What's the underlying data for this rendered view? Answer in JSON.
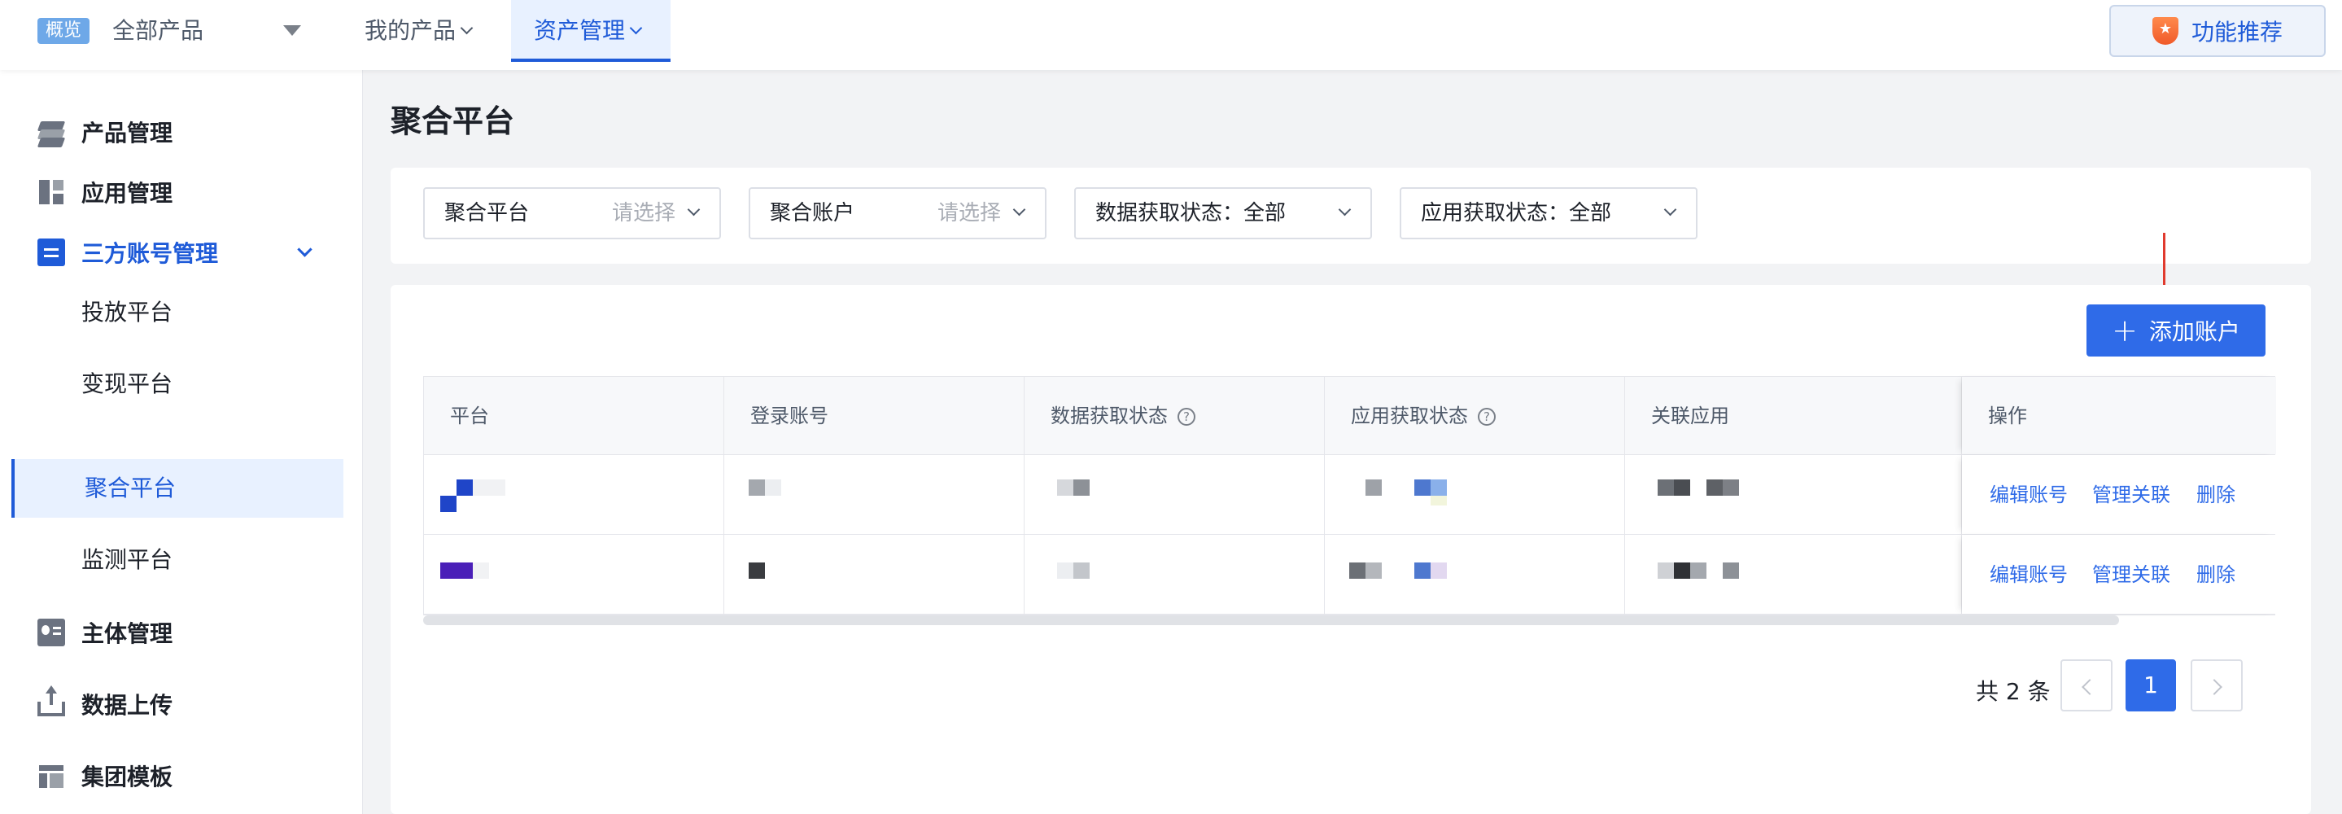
{
  "topnav": {
    "overview_badge": "概览",
    "product_select": "全部产品",
    "tabs": [
      {
        "label": "我的产品",
        "active": false
      },
      {
        "label": "资产管理",
        "active": true
      }
    ],
    "feature_button": "功能推荐"
  },
  "sidebar": {
    "items": [
      {
        "label": "产品管理",
        "icon": "layers-icon"
      },
      {
        "label": "应用管理",
        "icon": "grid-icon"
      },
      {
        "label": "三方账号管理",
        "icon": "document-icon",
        "expanded": true
      },
      {
        "label": "主体管理",
        "icon": "id-card-icon"
      },
      {
        "label": "数据上传",
        "icon": "upload-icon"
      },
      {
        "label": "集团模板",
        "icon": "template-icon"
      }
    ],
    "sub_items": [
      {
        "label": "投放平台",
        "selected": false
      },
      {
        "label": "变现平台",
        "selected": false
      },
      {
        "label": "聚合平台",
        "selected": true
      },
      {
        "label": "监测平台",
        "selected": false
      }
    ]
  },
  "main": {
    "title": "聚合平台",
    "filters": [
      {
        "label": "聚合平台",
        "placeholder": "请选择"
      },
      {
        "label": "聚合账户",
        "placeholder": "请选择"
      },
      {
        "label": "数据获取状态：全部",
        "placeholder": ""
      },
      {
        "label": "应用获取状态：全部",
        "placeholder": ""
      }
    ],
    "add_button": "添加账户",
    "table": {
      "columns": [
        "平台",
        "登录账号",
        "数据获取状态",
        "应用获取状态",
        "关联应用",
        "操作"
      ],
      "help_mark": "?",
      "actions": [
        "编辑账号",
        "管理关联",
        "删除"
      ],
      "row_count": 2
    },
    "pagination": {
      "total": "共 2 条",
      "current_page": "1"
    }
  },
  "colors": {
    "accent": "#2f6be8",
    "active_nav_bg": "#e8f1ff",
    "annotation_arrow": "#e03a2e"
  }
}
